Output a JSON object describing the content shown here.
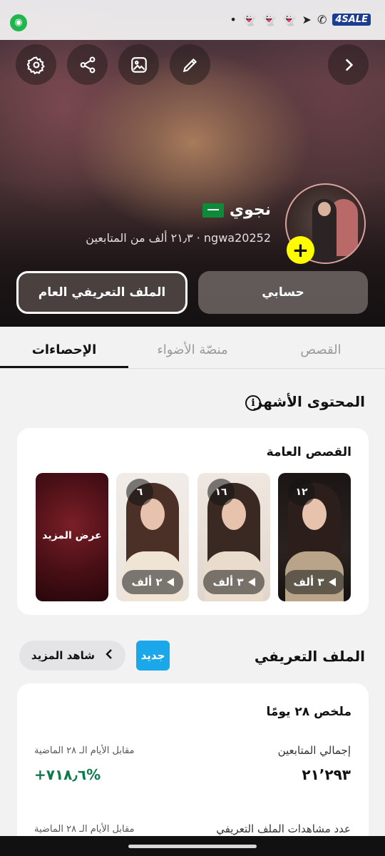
{
  "status_bar": {
    "left_icon": "camera-icon",
    "right_icons": [
      "dot-icon",
      "snapchat-icon",
      "snapchat-icon",
      "snapchat-icon",
      "telegram-icon",
      "whatsapp-icon"
    ],
    "brand_text": "4SALE"
  },
  "header": {
    "buttons": [
      "settings-icon",
      "share-icon",
      "edit-background-icon",
      "edit-pencil-icon",
      "chevron-forward-icon"
    ],
    "name": "نجوي",
    "flag_icon": "saudi-flag-icon",
    "handle": "ngwa20252",
    "followers_text": "٢١٫٣ ألف من المتابعين",
    "separator": "·",
    "public_profile_button": "الملف التعريفي العام",
    "account_button": "حسابي"
  },
  "tabs": [
    {
      "label": "القصص",
      "active": false
    },
    {
      "label": "منصّة الأضواء",
      "active": false
    },
    {
      "label": "الإحصاءات",
      "active": true
    }
  ],
  "top_content": {
    "title": "المحتوى الأشهر",
    "card_title": "القصص العامة",
    "stories": [
      {
        "count": "١٢",
        "views": "٣ ألف"
      },
      {
        "count": "١٦",
        "views": "٣ ألف"
      },
      {
        "count": "٦",
        "views": "٢ ألف"
      }
    ],
    "see_more_tile": "عرض المزيد"
  },
  "profile_section": {
    "title": "الملف التعريفي",
    "new_badge": "جديد",
    "see_more_button": "شاهد المزيد",
    "summary_title": "ملخص ٢٨ يومًا",
    "stats": [
      {
        "label": "إجمالي المتابعين",
        "compare": "مقابل الأيام الـ ٢٨ الماضية",
        "value": "٢١٬٢٩٣",
        "change": "+٧١٨٫٦%"
      },
      {
        "label": "عدد مشاهدات الملف التعريفي",
        "compare": "مقابل الأيام الـ ٢٨ الماضية"
      }
    ]
  },
  "colors": {
    "accent_yellow": "#fffc00",
    "new_badge_blue": "#1aa8ea",
    "positive_green": "#0f7a49"
  }
}
